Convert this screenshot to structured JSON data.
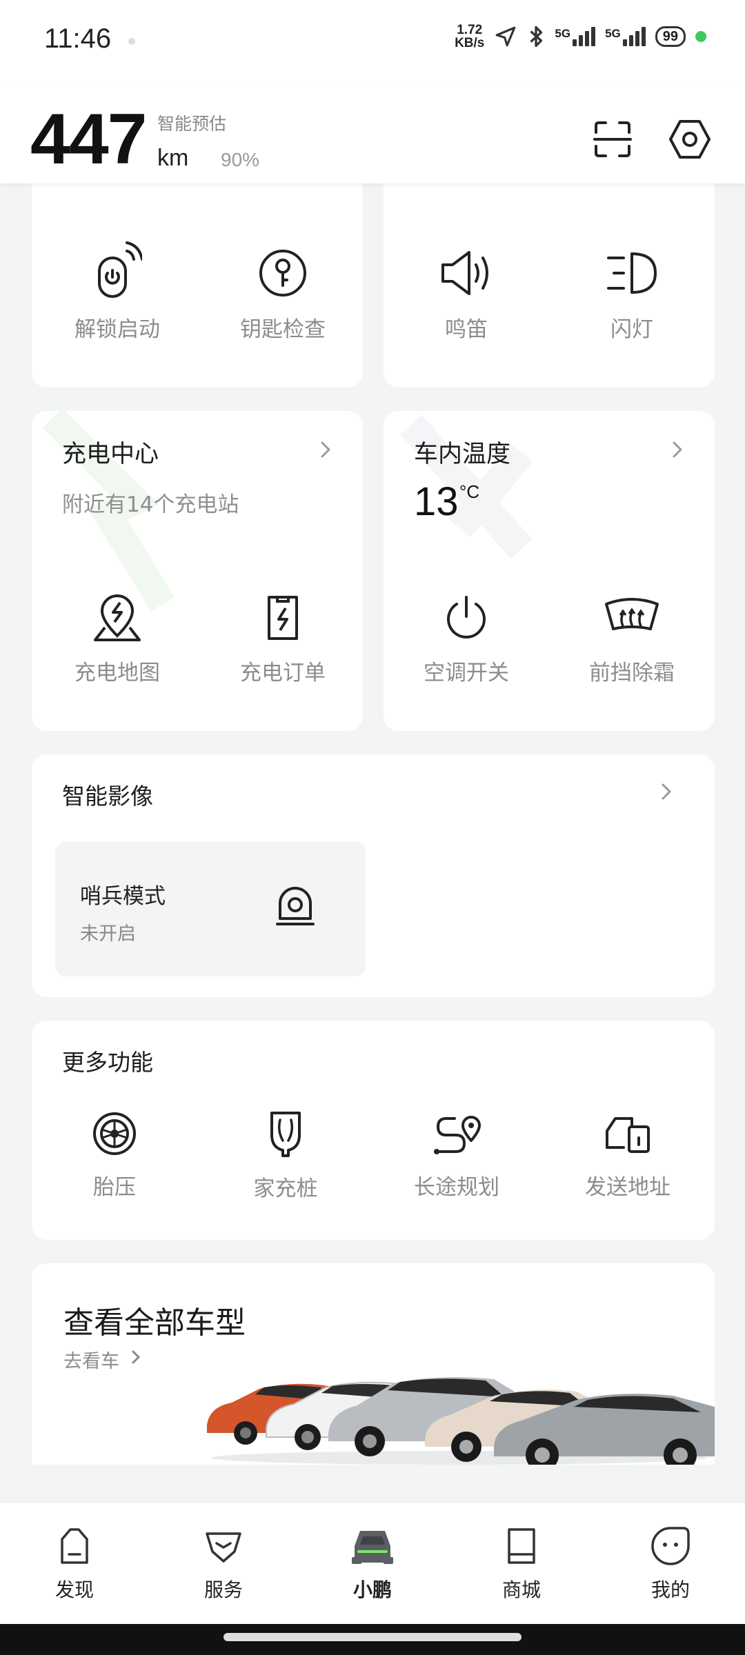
{
  "status_bar": {
    "time": "11:46",
    "net_speed_value": "1.72",
    "net_speed_unit": "KB/s",
    "sim1": "5G",
    "sim2": "5G",
    "battery": "99",
    "icons": [
      "location-arrow-icon",
      "bluetooth-icon",
      "signal-icon",
      "battery-icon"
    ]
  },
  "header": {
    "range_value": "447",
    "range_label": "智能预估",
    "range_unit": "km",
    "battery_percent": "90%",
    "icons": [
      "scan-icon",
      "settings-icon"
    ]
  },
  "remote": {
    "left_tiles": [
      {
        "label": "解锁启动",
        "icon": "remote-start-icon"
      },
      {
        "label": "钥匙检查",
        "icon": "key-icon"
      }
    ],
    "right_tiles": [
      {
        "label": "鸣笛",
        "icon": "horn-icon"
      },
      {
        "label": "闪灯",
        "icon": "headlight-icon"
      }
    ]
  },
  "charging": {
    "title": "充电中心",
    "subtitle": "附近有14个充电站",
    "tiles": [
      {
        "label": "充电地图",
        "icon": "charging-map-icon"
      },
      {
        "label": "充电订单",
        "icon": "charging-order-icon"
      }
    ]
  },
  "climate": {
    "title": "车内温度",
    "temperature": "13",
    "unit": "°C",
    "tiles": [
      {
        "label": "空调开关",
        "icon": "power-icon"
      },
      {
        "label": "前挡除霜",
        "icon": "defrost-icon"
      }
    ]
  },
  "camera": {
    "title": "智能影像",
    "sentry_title": "哨兵模式",
    "sentry_status": "未开启"
  },
  "more": {
    "title": "更多功能",
    "items": [
      {
        "label": "胎压",
        "icon": "tire-icon"
      },
      {
        "label": "家充桩",
        "icon": "home-charger-icon"
      },
      {
        "label": "长途规划",
        "icon": "route-icon"
      },
      {
        "label": "发送地址",
        "icon": "send-address-icon"
      }
    ]
  },
  "models": {
    "title": "查看全部车型",
    "link": "去看车"
  },
  "nav": {
    "items": [
      {
        "label": "发现",
        "icon": "discover-icon",
        "active": false
      },
      {
        "label": "服务",
        "icon": "service-icon",
        "active": false
      },
      {
        "label": "小鹏",
        "icon": "car-icon",
        "active": true
      },
      {
        "label": "商城",
        "icon": "mall-icon",
        "active": false
      },
      {
        "label": "我的",
        "icon": "profile-icon",
        "active": false
      }
    ]
  },
  "colors": {
    "accent_green": "#7be86a",
    "status_dot": "#3ec95f",
    "text_primary": "#1d1d1d",
    "text_secondary": "#8c8c8c",
    "background": "#f3f4f4"
  }
}
